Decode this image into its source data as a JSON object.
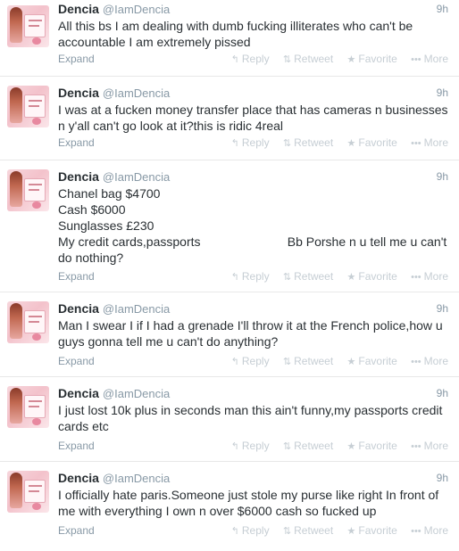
{
  "actions": {
    "expand": "Expand",
    "reply": "Reply",
    "retweet": "Retweet",
    "favorite": "Favorite",
    "more": "More",
    "reply_glyph": "↰",
    "retweet_glyph": "⇅",
    "favorite_glyph": "★",
    "more_glyph": "•••"
  },
  "tweets": [
    {
      "name": "Dencia",
      "handle": "@IamDencia",
      "time": "9h",
      "text": "All this bs I am dealing with dumb fucking illiterates who can't be accountable I am extremely pissed"
    },
    {
      "name": "Dencia",
      "handle": "@IamDencia",
      "time": "9h",
      "text": "I was at a fucken money transfer place that has cameras n businesses n y'all can't go look at it?this is ridic 4real"
    },
    {
      "name": "Dencia",
      "handle": "@IamDencia",
      "time": "9h",
      "text": "Chanel bag $4700\nCash $6000\nSunglasses £230\nMy credit cards,passports                         Bb Porshe n u tell me u can't do nothing?"
    },
    {
      "name": "Dencia",
      "handle": "@IamDencia",
      "time": "9h",
      "text": "Man I swear I if I had a grenade I'll throw it at the French police,how u guys gonna tell me u can't do anything?"
    },
    {
      "name": "Dencia",
      "handle": "@IamDencia",
      "time": "9h",
      "text": "I just lost 10k plus in seconds man this ain't funny,my passports credit cards etc"
    },
    {
      "name": "Dencia",
      "handle": "@IamDencia",
      "time": "9h",
      "text": "I officially hate paris.Someone just stole my purse like right In front of me with everything I own n over $6000 cash so fucked up"
    }
  ]
}
